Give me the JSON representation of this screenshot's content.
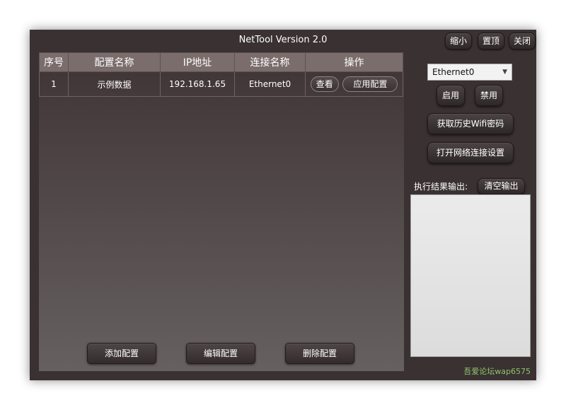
{
  "window": {
    "title": "NetTool Version 2.0",
    "buttons": {
      "minimize": "缩小",
      "pin": "置顶",
      "close": "关闭"
    }
  },
  "table": {
    "headers": [
      "序号",
      "配置名称",
      "IP地址",
      "连接名称",
      "操作"
    ],
    "rows": [
      {
        "index": "1",
        "name": "示例数据",
        "ip": "192.168.1.65",
        "connection": "Ethernet0",
        "view_label": "查看",
        "apply_label": "应用配置"
      }
    ]
  },
  "bottom": {
    "add_label": "添加配置",
    "edit_label": "编辑配置",
    "delete_label": "删除配置"
  },
  "side": {
    "adapter_selected": "Ethernet0",
    "enable_label": "启用",
    "disable_label": "禁用",
    "wifi_label": "获取历史Wifi密码",
    "netconn_label": "打开网络连接设置",
    "output_label": "执行结果输出:",
    "clear_label": "清空输出",
    "output_text": ""
  },
  "watermark": "吾爱论坛wap6575",
  "colors": {
    "window_bg": "#3a3132",
    "header_bg": "#7a6d6c",
    "watermark": "#8fc46a"
  }
}
